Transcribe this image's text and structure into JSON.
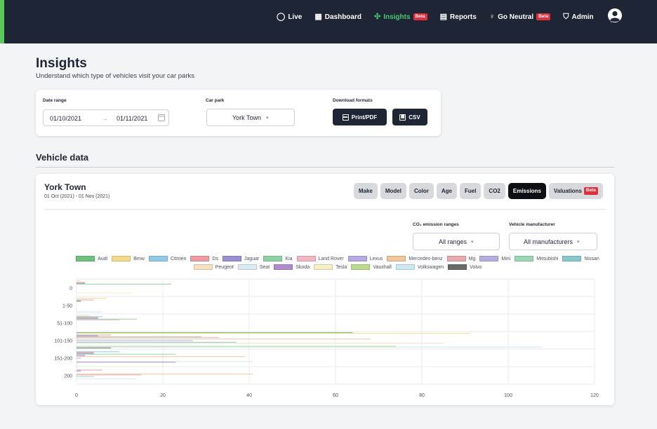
{
  "nav": {
    "items": [
      {
        "icon": "live-icon",
        "glyph": "◯",
        "label": "Live",
        "active": false,
        "beta": false
      },
      {
        "icon": "dashboard-icon",
        "glyph": "▦",
        "label": "Dashboard",
        "active": false,
        "beta": false
      },
      {
        "icon": "insights-icon",
        "glyph": "✣",
        "label": "Insights",
        "active": true,
        "beta": true
      },
      {
        "icon": "reports-icon",
        "glyph": "▤",
        "label": "Reports",
        "active": false,
        "beta": false
      },
      {
        "icon": "go-neutral-icon",
        "glyph": "♀",
        "label": "Go Neutral",
        "active": false,
        "beta": true
      },
      {
        "icon": "admin-shield-icon",
        "glyph": "⛉",
        "label": "Admin",
        "active": false,
        "beta": false
      }
    ],
    "beta_label": "Beta",
    "accent": "#48c774",
    "background": "#1e2535"
  },
  "header": {
    "title": "Insights",
    "subtitle": "Understand which type of vehicles visit your car parks"
  },
  "filters": {
    "date_range_label": "Date range",
    "date_from": "01/10/2021",
    "date_to": "01/11/2021",
    "car_park_label": "Car park",
    "car_park_value": "York Town",
    "download_label": "Download formats",
    "print_label": "Print/PDF",
    "csv_label": "CSV"
  },
  "section": {
    "title": "Vehicle data"
  },
  "card": {
    "location": "York Town",
    "range": "01 Oct (2021) - 01 Nov (2021)",
    "tabs": [
      {
        "label": "Make",
        "active": false,
        "beta": false
      },
      {
        "label": "Model",
        "active": false,
        "beta": false
      },
      {
        "label": "Color",
        "active": false,
        "beta": false
      },
      {
        "label": "Age",
        "active": false,
        "beta": false
      },
      {
        "label": "Fuel",
        "active": false,
        "beta": false
      },
      {
        "label": "CO2",
        "active": false,
        "beta": false
      },
      {
        "label": "Emissions",
        "active": true,
        "beta": false
      },
      {
        "label": "Valuations",
        "active": false,
        "beta": true
      }
    ],
    "emission_ranges_label": "CO₂ emission ranges",
    "emission_ranges_value": "All ranges",
    "manufacturer_label": "Vehicle manufacturer",
    "manufacturer_value": "All manufacturers"
  },
  "chart_data": {
    "type": "bar",
    "orientation": "horizontal",
    "categories": [
      "0",
      "1-50",
      "51-100",
      "101-150",
      "151-200",
      "200"
    ],
    "xlim": [
      0,
      120
    ],
    "xticks": [
      "0",
      "20",
      "40",
      "60",
      "80",
      "100",
      "120"
    ],
    "grid": true,
    "legend_position": "top",
    "series": [
      {
        "name": "Audi",
        "color": "#6cc37c",
        "values": [
          0,
          0,
          0,
          64,
          0,
          0
        ]
      },
      {
        "name": "Bmw",
        "color": "#f5d98a",
        "values": [
          1,
          7,
          3,
          91,
          0,
          0
        ]
      },
      {
        "name": "Citroen",
        "color": "#8ecbe8",
        "values": [
          0,
          0,
          6,
          0,
          10,
          0
        ]
      },
      {
        "name": "Ds",
        "color": "#f29aa4",
        "values": [
          2,
          4,
          5,
          8,
          4,
          6
        ]
      },
      {
        "name": "Jaguar",
        "color": "#9a8fd6",
        "values": [
          2,
          1,
          5,
          5,
          4,
          1
        ]
      },
      {
        "name": "Kia",
        "color": "#8fd2a1",
        "values": [
          22,
          1,
          14,
          29,
          23,
          0
        ]
      },
      {
        "name": "Land Rover",
        "color": "#f4b6c0",
        "values": [
          0,
          0,
          10,
          33,
          2,
          0
        ]
      },
      {
        "name": "Lexus",
        "color": "#b5a9e6",
        "values": [
          0,
          0,
          0,
          0,
          2,
          0
        ]
      },
      {
        "name": "Mercedes-benz",
        "color": "#f2c49a",
        "values": [
          0,
          0,
          0,
          68,
          39,
          41
        ]
      },
      {
        "name": "Mg",
        "color": "#eba9ad",
        "values": [
          0,
          0,
          0,
          0,
          0,
          15
        ]
      },
      {
        "name": "Mini",
        "color": "#b3aedf",
        "values": [
          0,
          0,
          0,
          27,
          1,
          0
        ]
      },
      {
        "name": "Mitsubishi",
        "color": "#9bd7b5",
        "values": [
          0,
          0,
          0,
          0,
          0,
          4
        ]
      },
      {
        "name": "Nissan",
        "color": "#83c9cf",
        "values": [
          0,
          0,
          0,
          37,
          0,
          0
        ]
      },
      {
        "name": "Peugeot",
        "color": "#f7e0c1",
        "values": [
          0,
          0,
          0,
          85,
          0,
          0
        ]
      },
      {
        "name": "Seat",
        "color": "#d8ecf5",
        "values": [
          0,
          0,
          0,
          0,
          41,
          14
        ]
      },
      {
        "name": "Skoda",
        "color": "#b18ad0",
        "values": [
          0,
          0,
          0,
          0,
          23,
          0
        ]
      },
      {
        "name": "Tesla",
        "color": "#f6f0c4",
        "values": [
          13,
          0,
          0,
          0,
          0,
          0
        ]
      },
      {
        "name": "Vauxhall",
        "color": "#b8db8c",
        "values": [
          0,
          0,
          0,
          74,
          0,
          0
        ]
      },
      {
        "name": "Volkswagen",
        "color": "#c9e8f2",
        "values": [
          0,
          6,
          0,
          108,
          0,
          0
        ]
      },
      {
        "name": "Volvo",
        "color": "#6b6b6b",
        "values": [
          0,
          0,
          0,
          8,
          0,
          0
        ]
      }
    ]
  }
}
